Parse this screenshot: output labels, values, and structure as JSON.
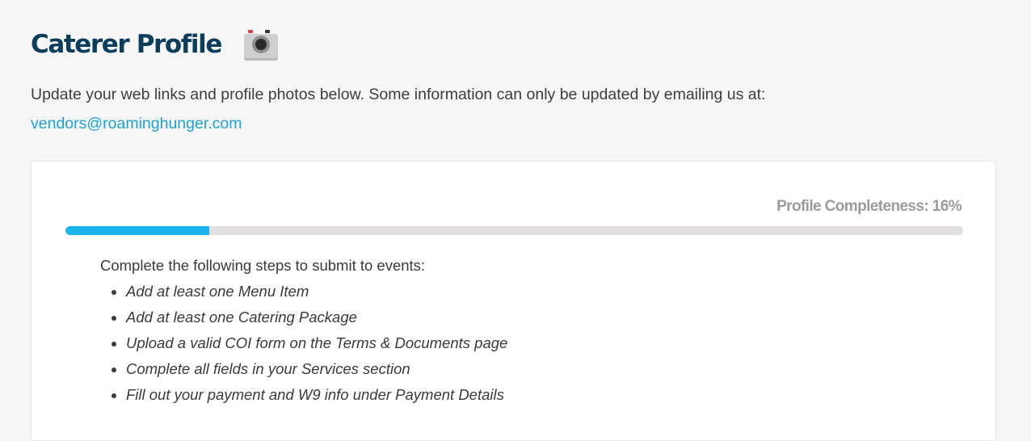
{
  "header": {
    "title": "Caterer Profile",
    "icon": "camera-icon"
  },
  "intro": {
    "text": "Update your web links and profile photos below. Some information can only be updated by emailing us at:",
    "email": "vendors@roaminghunger.com"
  },
  "profile": {
    "completeness_label": "Profile Completeness: 16%",
    "completeness_fraction": 0.16,
    "steps_lead": "Complete the following steps to submit to events:",
    "steps": [
      "Add at least one Menu Item",
      "Add at least one Catering Package",
      "Upload a valid COI form on the Terms & Documents page",
      "Complete all fields in your Services section",
      "Fill out your payment and W9 info under Payment Details"
    ]
  },
  "colors": {
    "title": "#0b3d5c",
    "link": "#1da1e0",
    "progress_fill": "#1ab3ea",
    "progress_track": "#e1dfdf"
  }
}
